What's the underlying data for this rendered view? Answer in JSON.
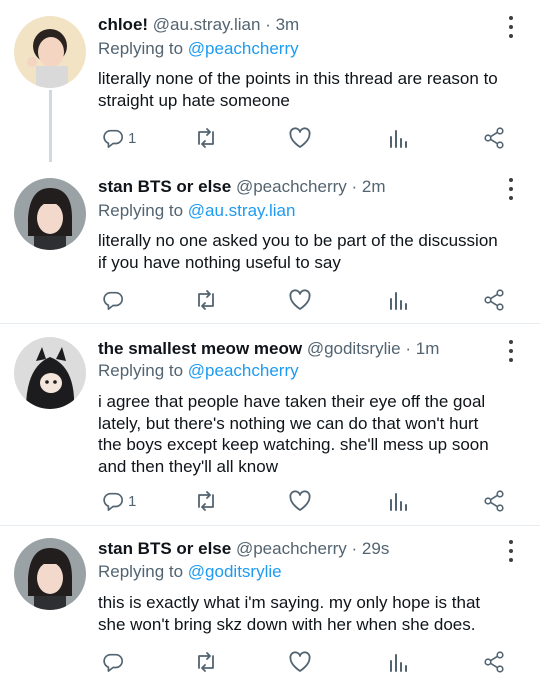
{
  "tweets": [
    {
      "name": "chloe!",
      "handle": "@au.stray.lian",
      "time": "3m",
      "replying_prefix": "Replying to",
      "replying_to": "@peachcherry",
      "lines": [
        "literally none of the points in this thread are reason to",
        "straight up hate someone"
      ],
      "reply_count": "1"
    },
    {
      "name": "stan BTS or else",
      "handle": "@peachcherry",
      "time": "2m",
      "replying_prefix": "Replying to",
      "replying_to": "@au.stray.lian",
      "lines": [
        "literally no one asked you to be part of the discussion",
        "if you have nothing useful to say"
      ],
      "reply_count": ""
    },
    {
      "name": "the smallest meow meow",
      "handle": "@goditsrylie",
      "time": "1m",
      "replying_prefix": "Replying to",
      "replying_to": "@peachcherry",
      "lines": [
        "i agree that people have taken their eye off the goal",
        "lately, but there's nothing we can do that won't hurt",
        "the boys except keep watching. she'll mess up soon",
        "and then they'll all know"
      ],
      "reply_count": "1"
    },
    {
      "name": "stan BTS or else",
      "handle": "@peachcherry",
      "time": "29s",
      "replying_prefix": "Replying to",
      "replying_to": "@goditsrylie",
      "lines": [
        "this is exactly what i'm saying. my only hope is that",
        "she won't bring skz down with her when she does."
      ],
      "reply_count": ""
    }
  ],
  "separator": "·",
  "icons": [
    "reply-icon",
    "retweet-icon",
    "like-icon",
    "analytics-icon",
    "share-icon",
    "more-icon"
  ],
  "colors": {
    "mention": "#1d9bf0",
    "secondary": "#536471",
    "icon": "#536471"
  }
}
